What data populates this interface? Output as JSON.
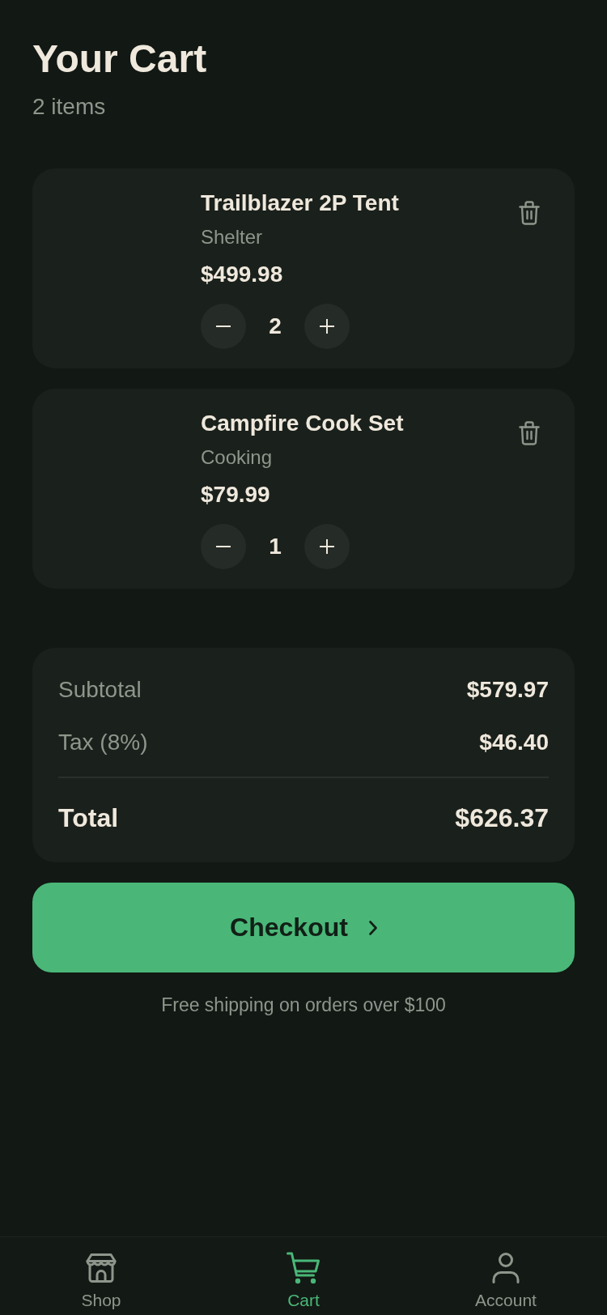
{
  "header": {
    "title": "Your Cart",
    "subtitle": "2 items"
  },
  "items": [
    {
      "name": "Trailblazer 2P Tent",
      "category": "Shelter",
      "price": "$499.98",
      "quantity": "2"
    },
    {
      "name": "Campfire Cook Set",
      "category": "Cooking",
      "price": "$79.99",
      "quantity": "1"
    }
  ],
  "summary": {
    "rows": [
      {
        "label": "Subtotal",
        "value": "$579.97"
      },
      {
        "label": "Tax (8%)",
        "value": "$46.40"
      }
    ],
    "total": {
      "label": "Total",
      "value": "$626.37"
    }
  },
  "checkout": {
    "label": "Checkout"
  },
  "note": "Free shipping on orders over $100",
  "nav": [
    {
      "label": "Shop",
      "selected": false
    },
    {
      "label": "Cart",
      "selected": true
    },
    {
      "label": "Account",
      "selected": false
    }
  ]
}
